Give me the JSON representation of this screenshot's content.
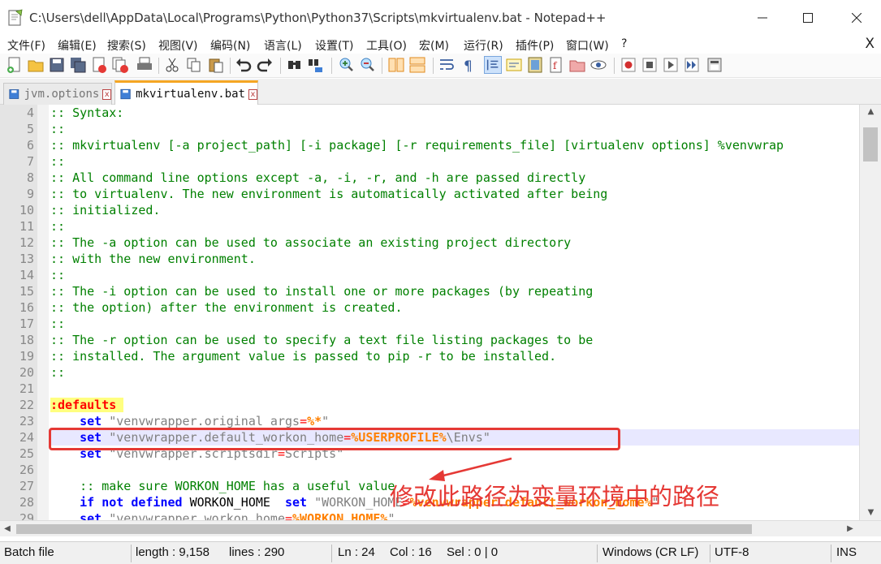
{
  "window": {
    "title": "C:\\Users\\dell\\AppData\\Local\\Programs\\Python\\Python37\\Scripts\\mkvirtualenv.bat - Notepad++",
    "minimize": "—",
    "maximize": "☐",
    "close": "✕"
  },
  "menu": {
    "items": [
      "文件(F)",
      "编辑(E)",
      "搜索(S)",
      "视图(V)",
      "编码(N)",
      "语言(L)",
      "设置(T)",
      "工具(O)",
      "宏(M)",
      "运行(R)",
      "插件(P)",
      "窗口(W)",
      "?"
    ],
    "close": "X"
  },
  "toolbar": {
    "icons": [
      "new-file-icon",
      "open-file-icon",
      "save-icon",
      "save-all-icon",
      "close-icon",
      "close-all-icon",
      "print-icon",
      "cut-icon",
      "copy-icon",
      "paste-icon",
      "undo-icon",
      "redo-icon",
      "find-icon",
      "replace-icon",
      "zoom-in-icon",
      "zoom-out-icon",
      "sync-vertical-icon",
      "sync-horizontal-icon",
      "word-wrap-icon",
      "show-all-chars-icon",
      "indent-guide-icon",
      "udl-icon",
      "doc-map-icon",
      "function-list-icon",
      "folder-workspace-icon",
      "monitor-icon",
      "record-macro-icon",
      "stop-macro-icon",
      "play-macro-icon",
      "run-macro-multiple-icon",
      "save-macro-icon"
    ]
  },
  "tabs": [
    {
      "label": "jvm.options",
      "active": false
    },
    {
      "label": "mkvirtualenv.bat",
      "active": true
    }
  ],
  "editor": {
    "lines": [
      {
        "n": "4",
        "segs": [
          {
            "t": ":: Syntax:",
            "c": "comment"
          }
        ]
      },
      {
        "n": "5",
        "segs": [
          {
            "t": "::",
            "c": "comment"
          }
        ]
      },
      {
        "n": "6",
        "segs": [
          {
            "t": ":: mkvirtualenv [-a project_path] [-i package] [-r requirements_file] [virtualenv options] %venvwrap",
            "c": "comment"
          }
        ]
      },
      {
        "n": "7",
        "segs": [
          {
            "t": "::",
            "c": "comment"
          }
        ]
      },
      {
        "n": "8",
        "segs": [
          {
            "t": ":: All command line options except -a, -i, -r, and -h are passed directly",
            "c": "comment"
          }
        ]
      },
      {
        "n": "9",
        "segs": [
          {
            "t": ":: to virtualenv. The new environment is automatically activated after being",
            "c": "comment"
          }
        ]
      },
      {
        "n": "10",
        "segs": [
          {
            "t": ":: initialized.",
            "c": "comment"
          }
        ]
      },
      {
        "n": "11",
        "segs": [
          {
            "t": "::",
            "c": "comment"
          }
        ]
      },
      {
        "n": "12",
        "segs": [
          {
            "t": ":: The -a option can be used to associate an existing project directory",
            "c": "comment"
          }
        ]
      },
      {
        "n": "13",
        "segs": [
          {
            "t": ":: with the new environment.",
            "c": "comment"
          }
        ]
      },
      {
        "n": "14",
        "segs": [
          {
            "t": "::",
            "c": "comment"
          }
        ]
      },
      {
        "n": "15",
        "segs": [
          {
            "t": ":: The -i option can be used to install one or more packages (by repeating",
            "c": "comment"
          }
        ]
      },
      {
        "n": "16",
        "segs": [
          {
            "t": ":: the option) after the environment is created.",
            "c": "comment"
          }
        ]
      },
      {
        "n": "17",
        "segs": [
          {
            "t": "::",
            "c": "comment"
          }
        ]
      },
      {
        "n": "18",
        "segs": [
          {
            "t": ":: The -r option can be used to specify a text file listing packages to be",
            "c": "comment"
          }
        ]
      },
      {
        "n": "19",
        "segs": [
          {
            "t": ":: installed. The argument value is passed to pip -r to be installed.",
            "c": "comment"
          }
        ]
      },
      {
        "n": "20",
        "segs": [
          {
            "t": "::",
            "c": "comment"
          }
        ]
      },
      {
        "n": "21",
        "segs": []
      },
      {
        "n": "22",
        "segs": [
          {
            "t": ":defaults ",
            "c": "label"
          }
        ]
      },
      {
        "n": "23",
        "segs": [
          {
            "t": "    ",
            "c": "plain"
          },
          {
            "t": "set",
            "c": "kw"
          },
          {
            "t": " \"venvwrapper.original_args",
            "c": "str"
          },
          {
            "t": "=",
            "c": "op"
          },
          {
            "t": "%*",
            "c": "var"
          },
          {
            "t": "\"",
            "c": "str"
          }
        ]
      },
      {
        "n": "24",
        "segs": [
          {
            "t": "    ",
            "c": "plain"
          },
          {
            "t": "set",
            "c": "kw"
          },
          {
            "t": " \"venvwrapper.default_workon_home",
            "c": "str"
          },
          {
            "t": "=",
            "c": "op"
          },
          {
            "t": "%USERPROFILE%",
            "c": "var"
          },
          {
            "t": "\\Envs\"",
            "c": "str"
          }
        ]
      },
      {
        "n": "25",
        "segs": [
          {
            "t": "    ",
            "c": "plain"
          },
          {
            "t": "set",
            "c": "kw"
          },
          {
            "t": " \"venvwrapper.scriptsdir",
            "c": "str"
          },
          {
            "t": "=",
            "c": "op"
          },
          {
            "t": "Scripts\"",
            "c": "str"
          }
        ]
      },
      {
        "n": "26",
        "segs": []
      },
      {
        "n": "27",
        "segs": [
          {
            "t": "    :: make sure WORKON_HOME has a useful value",
            "c": "comment"
          }
        ]
      },
      {
        "n": "28",
        "segs": [
          {
            "t": "    ",
            "c": "plain"
          },
          {
            "t": "if not defined",
            "c": "kw"
          },
          {
            "t": " WORKON_HOME  ",
            "c": "plain"
          },
          {
            "t": "set",
            "c": "kw"
          },
          {
            "t": " \"WORKON_HOME",
            "c": "str"
          },
          {
            "t": "=",
            "c": "op"
          },
          {
            "t": "%venvwrapper.default_workon_home%",
            "c": "var"
          },
          {
            "t": "\"",
            "c": "str"
          }
        ]
      },
      {
        "n": "29",
        "segs": [
          {
            "t": "    ",
            "c": "plain"
          },
          {
            "t": "set",
            "c": "kw"
          },
          {
            "t": " \"venvwrapper.workon_home",
            "c": "str"
          },
          {
            "t": "=",
            "c": "op"
          },
          {
            "t": "%WORKON_HOME%",
            "c": "var"
          },
          {
            "t": "\"",
            "c": "str"
          }
        ]
      }
    ]
  },
  "annotation": {
    "text": "修改此路径为变量环境中的路径",
    "color": "#e53935"
  },
  "status": {
    "filetype": "Batch file",
    "length": "length : 9,158",
    "lines": "lines : 290",
    "ln": "Ln : 24",
    "col": "Col : 16",
    "sel": "Sel : 0 | 0",
    "eol": "Windows (CR LF)",
    "encoding": "UTF-8",
    "mode": "INS"
  }
}
